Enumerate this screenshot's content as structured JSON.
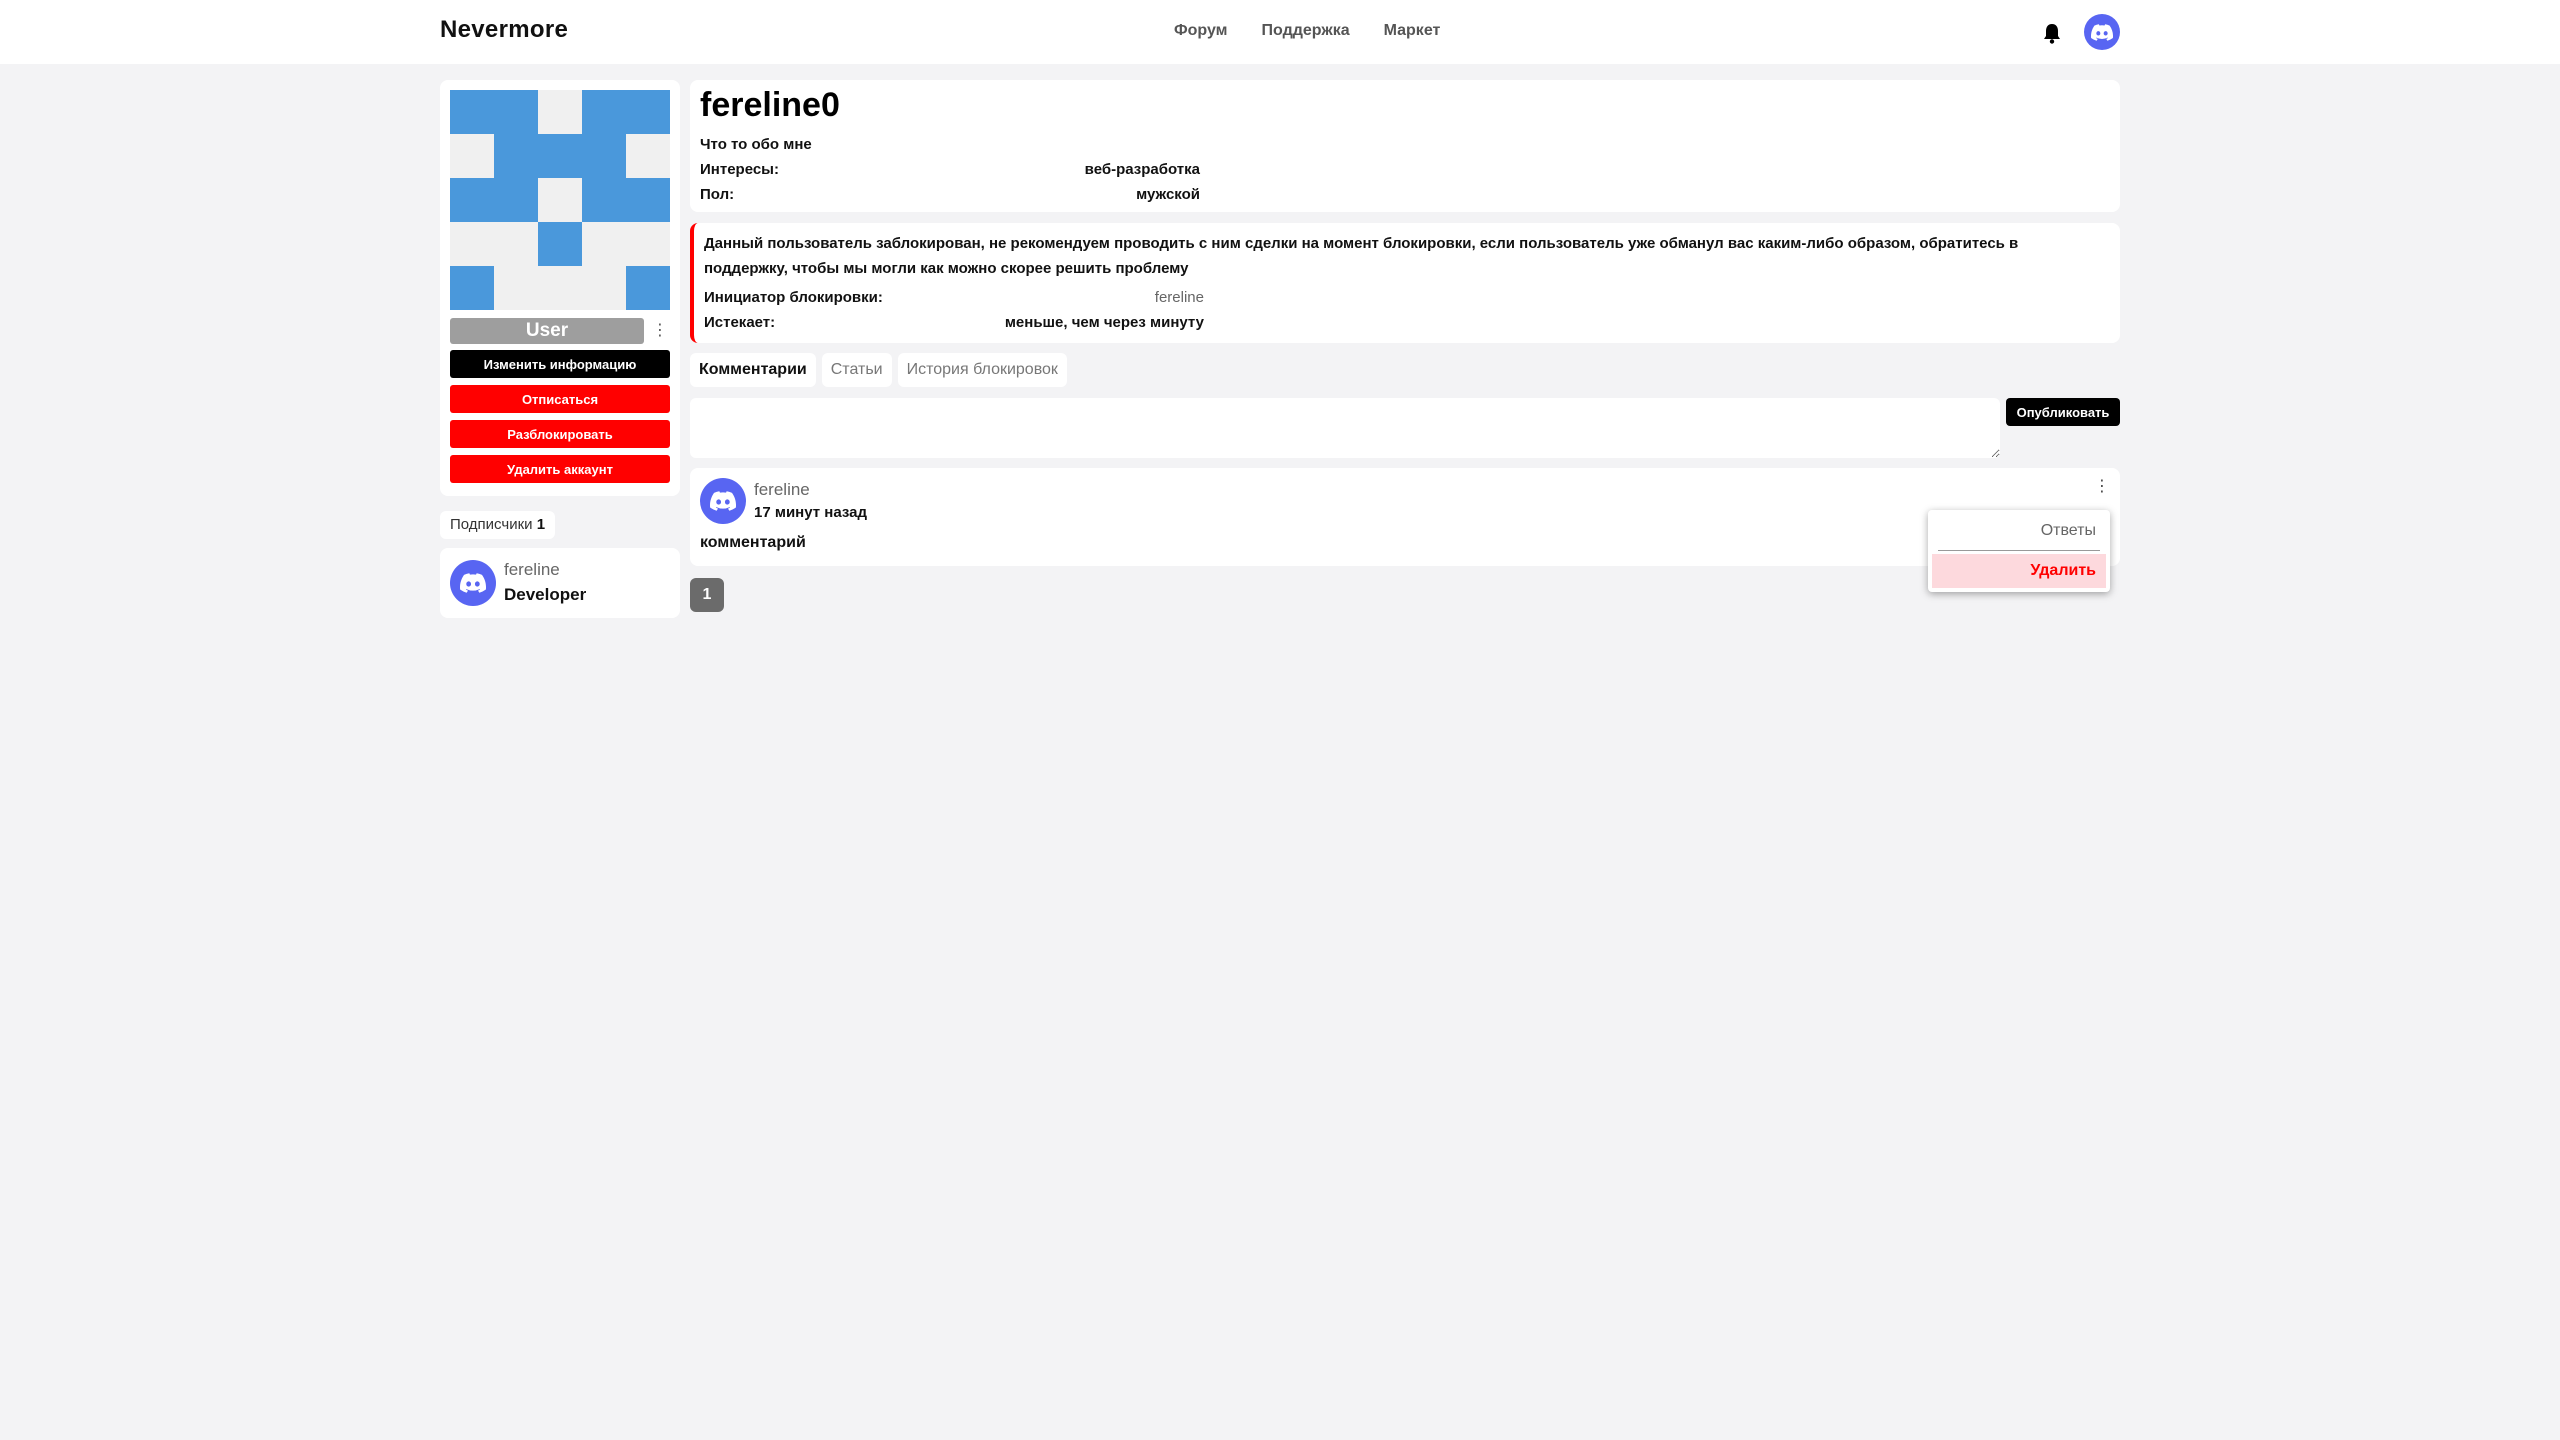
{
  "header": {
    "brand": "Nevermore",
    "nav": [
      "Форум",
      "Поддержка",
      "Маркет"
    ]
  },
  "profile": {
    "role_badge": "User",
    "role_badge_color": "#9e9e9e",
    "identicon_color": "#4a98db",
    "buttons": {
      "edit": "Изменить информацию",
      "unsubscribe": "Отписаться",
      "unban": "Разблокировать",
      "delete_account": "Удалить аккаунт"
    }
  },
  "subscribers": {
    "label": "Подписчики",
    "count": "1",
    "items": [
      {
        "name": "fereline",
        "role": "Developer"
      }
    ]
  },
  "info": {
    "username": "fereline0",
    "about": "Что то обо мне",
    "interests_label": "Интересы:",
    "interests_value": "веб-разработка",
    "gender_label": "Пол:",
    "gender_value": "мужской"
  },
  "ban": {
    "text": "Данный пользователь заблокирован, не рекомендуем проводить с ним сделки на момент блокировки, если пользователь уже обманул вас каким-либо образом, обратитесь в поддержку, чтобы мы могли как можно скорее решить проблему",
    "initiator_label": "Инициатор блокировки:",
    "initiator_value": "fereline",
    "expires_label": "Истекает:",
    "expires_value": "меньше, чем через минуту",
    "accent": "#ff0000"
  },
  "tabs": [
    "Комментарии",
    "Статьи",
    "История блокировок"
  ],
  "composer": {
    "placeholder": "",
    "publish_label": "Опубликовать"
  },
  "comment": {
    "author": "fereline",
    "time": "17 минут назад",
    "text": "комментарий"
  },
  "comment_menu": {
    "replies": "Ответы",
    "delete": "Удалить"
  },
  "pagination": {
    "current": "1"
  }
}
